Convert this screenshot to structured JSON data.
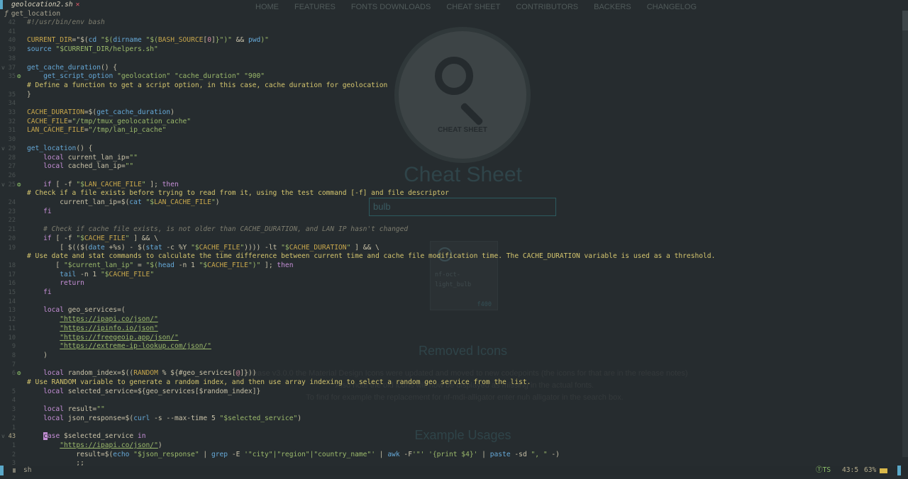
{
  "website": {
    "nav": [
      "HOME",
      "FEATURES",
      "FONTS DOWNLOADS",
      "CHEAT SHEET",
      "CONTRIBUTORS",
      "BACKERS",
      "CHANGELOG"
    ],
    "circle_label": "CHEAT SHEET",
    "title": "Cheat Sheet",
    "search_value": "bulb",
    "card_name_1": "nf-oct-",
    "card_name_2": "light_bulb",
    "card_code": "f400",
    "removed_title": "Removed Icons",
    "removed_text_1": "Release v3.0.0 the Material Design Icons were updated and moved to new codepoints (the icons for that are in the release notes)",
    "removed_text_2": "Also note the old icons will now be displayed as missing in the actual fonts.",
    "removed_text_3": "To find for example the replacement for nf-mdi-alligator enter nuh alligator in the search box.",
    "usage_title": "Example Usages"
  },
  "editor": {
    "tab_filename": "geolocation2.sh",
    "tab_modified": "✕",
    "winbar_icon": "ƒ",
    "winbar_symbol": "get_location",
    "filetype": "sh",
    "lsp": "ⓉTS",
    "cursor_pos": "43:5",
    "percent": "63%",
    "colors": {
      "accent": "#5aa8c8",
      "hint": "#d4c56e",
      "string": "#9bb96b",
      "function": "#66a9d8"
    }
  },
  "gutter": [
    {
      "n": "42",
      "fold": "",
      "bulb": false
    },
    {
      "n": "41",
      "fold": "",
      "bulb": false
    },
    {
      "n": "40",
      "fold": "",
      "bulb": false
    },
    {
      "n": "39",
      "fold": "",
      "bulb": false
    },
    {
      "n": "38",
      "fold": "",
      "bulb": false
    },
    {
      "n": "37",
      "fold": "v",
      "bulb": false
    },
    {
      "n": "35",
      "fold": "",
      "bulb": true
    },
    {
      "n": "",
      "fold": "",
      "bulb": false
    },
    {
      "n": "35",
      "fold": "",
      "bulb": false
    },
    {
      "n": "34",
      "fold": "",
      "bulb": false
    },
    {
      "n": "33",
      "fold": "",
      "bulb": false
    },
    {
      "n": "32",
      "fold": "",
      "bulb": false
    },
    {
      "n": "31",
      "fold": "",
      "bulb": false
    },
    {
      "n": "30",
      "fold": "",
      "bulb": false
    },
    {
      "n": "29",
      "fold": "v",
      "bulb": false
    },
    {
      "n": "28",
      "fold": "",
      "bulb": false
    },
    {
      "n": "27",
      "fold": "",
      "bulb": false
    },
    {
      "n": "26",
      "fold": "",
      "bulb": false
    },
    {
      "n": "25",
      "fold": "v",
      "bulb": true
    },
    {
      "n": "",
      "fold": "",
      "bulb": false
    },
    {
      "n": "24",
      "fold": "",
      "bulb": false
    },
    {
      "n": "23",
      "fold": "",
      "bulb": false
    },
    {
      "n": "22",
      "fold": "",
      "bulb": false
    },
    {
      "n": "21",
      "fold": "",
      "bulb": false
    },
    {
      "n": "20",
      "fold": "",
      "bulb": false
    },
    {
      "n": "19",
      "fold": "",
      "bulb": false
    },
    {
      "n": "",
      "fold": "",
      "bulb": false
    },
    {
      "n": "18",
      "fold": "",
      "bulb": false
    },
    {
      "n": "17",
      "fold": "",
      "bulb": false
    },
    {
      "n": "16",
      "fold": "",
      "bulb": false
    },
    {
      "n": "15",
      "fold": "",
      "bulb": false
    },
    {
      "n": "14",
      "fold": "",
      "bulb": false
    },
    {
      "n": "13",
      "fold": "",
      "bulb": false
    },
    {
      "n": "12",
      "fold": "",
      "bulb": false
    },
    {
      "n": "11",
      "fold": "",
      "bulb": false
    },
    {
      "n": "10",
      "fold": "",
      "bulb": false
    },
    {
      "n": "9",
      "fold": "",
      "bulb": false
    },
    {
      "n": "8",
      "fold": "",
      "bulb": false
    },
    {
      "n": "7",
      "fold": "",
      "bulb": false
    },
    {
      "n": "6",
      "fold": "",
      "bulb": true
    },
    {
      "n": "",
      "fold": "",
      "bulb": false
    },
    {
      "n": "5",
      "fold": "",
      "bulb": false
    },
    {
      "n": "4",
      "fold": "",
      "bulb": false
    },
    {
      "n": "3",
      "fold": "",
      "bulb": false
    },
    {
      "n": "2",
      "fold": "",
      "bulb": false
    },
    {
      "n": "1",
      "fold": "",
      "bulb": false
    },
    {
      "n": "43",
      "fold": "v",
      "bulb": false,
      "cur": true
    },
    {
      "n": "1",
      "fold": "",
      "bulb": false
    },
    {
      "n": "2",
      "fold": "",
      "bulb": false
    },
    {
      "n": "3",
      "fold": "",
      "bulb": false
    }
  ],
  "code_lines": [
    [
      [
        "cm",
        "#!/usr/bin/env bash"
      ]
    ],
    [],
    [
      [
        "vt",
        "CURRENT_DIR"
      ],
      [
        "op",
        "=\"$("
      ],
      [
        "fn",
        "cd"
      ],
      [
        "st",
        " \"$("
      ],
      [
        "fn",
        "dirname"
      ],
      [
        "st",
        " \"$("
      ],
      [
        "vt",
        "BASH_SOURCE"
      ],
      [
        "op",
        "["
      ],
      [
        "nm",
        "0"
      ],
      [
        "op",
        "]"
      ],
      [
        "st",
        "}\")\""
      ],
      [
        "op",
        " && "
      ],
      [
        "fn",
        "pwd"
      ],
      [
        "st",
        ")\""
      ]
    ],
    [
      [
        "fn",
        "source"
      ],
      [
        "st",
        " \"$CURRENT_DIR/helpers.sh\""
      ]
    ],
    [],
    [
      [
        "fn",
        "get_cache_duration"
      ],
      [
        "op",
        "() {"
      ]
    ],
    [
      [
        "op",
        "    "
      ],
      [
        "fn",
        "get_script_option"
      ],
      [
        "st",
        " \"geolocation\" \"cache_duration\" \"900\""
      ]
    ],
    [
      [
        "ai",
        "# Define a function to get a script option, in this case, cache duration for geolocation"
      ]
    ],
    [
      [
        "op",
        "}"
      ]
    ],
    [],
    [
      [
        "vt",
        "CACHE_DURATION"
      ],
      [
        "op",
        "=$("
      ],
      [
        "fn",
        "get_cache_duration"
      ],
      [
        "op",
        ")"
      ]
    ],
    [
      [
        "vt",
        "CACHE_FILE"
      ],
      [
        "op",
        "="
      ],
      [
        "st",
        "\"/tmp/tmux_geolocation_cache\""
      ]
    ],
    [
      [
        "vt",
        "LAN_CACHE_FILE"
      ],
      [
        "op",
        "="
      ],
      [
        "st",
        "\"/tmp/lan_ip_cache\""
      ]
    ],
    [],
    [
      [
        "fn",
        "get_location"
      ],
      [
        "op",
        "() {"
      ]
    ],
    [
      [
        "op",
        "    "
      ],
      [
        "kw",
        "local"
      ],
      [
        "op",
        " current_lan_ip="
      ],
      [
        "st",
        "\"\""
      ]
    ],
    [
      [
        "op",
        "    "
      ],
      [
        "kw",
        "local"
      ],
      [
        "op",
        " cached_lan_ip="
      ],
      [
        "st",
        "\"\""
      ]
    ],
    [],
    [
      [
        "op",
        "    "
      ],
      [
        "kw",
        "if"
      ],
      [
        "op",
        " [ -f "
      ],
      [
        "st",
        "\"$"
      ],
      [
        "vt",
        "LAN_CACHE_FILE"
      ],
      [
        "st",
        "\""
      ],
      [
        "op",
        " ]; "
      ],
      [
        "kw",
        "then"
      ]
    ],
    [
      [
        "ai",
        "# Check if a file exists before trying to read from it, using the test command [-f] and file descriptor"
      ]
    ],
    [
      [
        "op",
        "        current_lan_ip=$("
      ],
      [
        "fn",
        "cat"
      ],
      [
        "st",
        " \"$"
      ],
      [
        "vt",
        "LAN_CACHE_FILE"
      ],
      [
        "st",
        "\""
      ],
      [
        "op",
        ")"
      ]
    ],
    [
      [
        "op",
        "    "
      ],
      [
        "kw",
        "fi"
      ]
    ],
    [],
    [
      [
        "op",
        "    "
      ],
      [
        "cm",
        "# Check if cache file exists, is not older than CACHE_DURATION, and LAN IP hasn't changed"
      ]
    ],
    [
      [
        "op",
        "    "
      ],
      [
        "kw",
        "if"
      ],
      [
        "op",
        " [ -f "
      ],
      [
        "st",
        "\"$"
      ],
      [
        "vt",
        "CACHE_FILE"
      ],
      [
        "st",
        "\""
      ],
      [
        "op",
        " ] && \\"
      ]
    ],
    [
      [
        "op",
        "        [ $(($("
      ],
      [
        "fn",
        "date"
      ],
      [
        "op",
        " +%s) - $("
      ],
      [
        "fn",
        "stat"
      ],
      [
        "op",
        " -c %Y "
      ],
      [
        "st",
        "\"$"
      ],
      [
        "vt",
        "CACHE_FILE"
      ],
      [
        "st",
        "\""
      ],
      [
        "op",
        ")))) -lt "
      ],
      [
        "st",
        "\"$"
      ],
      [
        "vt",
        "CACHE_DURATION"
      ],
      [
        "st",
        "\""
      ],
      [
        "op",
        " ] && \\"
      ]
    ],
    [
      [
        "ai",
        "# Use date and stat commands to calculate the time difference between current time and cache file modification time. The CACHE_DURATION variable is used as a threshold."
      ]
    ],
    [
      [
        "op",
        "       [ "
      ],
      [
        "st",
        "\"$current_lan_ip\""
      ],
      [
        "op",
        " = "
      ],
      [
        "st",
        "\"$("
      ],
      [
        "fn",
        "head"
      ],
      [
        "op",
        " -n 1 "
      ],
      [
        "st",
        "\"$"
      ],
      [
        "vt",
        "CACHE_FILE"
      ],
      [
        "st",
        "\")\""
      ],
      [
        "op",
        " ]; "
      ],
      [
        "kw",
        "then"
      ]
    ],
    [
      [
        "op",
        "        "
      ],
      [
        "fn",
        "tail"
      ],
      [
        "op",
        " -n 1 "
      ],
      [
        "st",
        "\"$"
      ],
      [
        "vt",
        "CACHE_FILE"
      ],
      [
        "st",
        "\""
      ]
    ],
    [
      [
        "op",
        "        "
      ],
      [
        "kw",
        "return"
      ]
    ],
    [
      [
        "op",
        "    "
      ],
      [
        "kw",
        "fi"
      ]
    ],
    [],
    [
      [
        "op",
        "    "
      ],
      [
        "kw",
        "local"
      ],
      [
        "op",
        " geo_services=("
      ]
    ],
    [
      [
        "op",
        "        "
      ],
      [
        "url",
        "\"https://ipapi.co/json/\""
      ]
    ],
    [
      [
        "op",
        "        "
      ],
      [
        "url",
        "\"https://ipinfo.io/json\""
      ]
    ],
    [
      [
        "op",
        "        "
      ],
      [
        "url",
        "\"https://freegeoip.app/json/\""
      ]
    ],
    [
      [
        "op",
        "        "
      ],
      [
        "url",
        "\"https://extreme-ip-lookup.com/json/\""
      ]
    ],
    [
      [
        "op",
        "    )"
      ]
    ],
    [],
    [
      [
        "op",
        "    "
      ],
      [
        "kw",
        "local"
      ],
      [
        "op",
        " random_index=$(("
      ],
      [
        "vt",
        "RANDOM"
      ],
      [
        "op",
        " % ${#geo_services["
      ],
      [
        "nm",
        "@"
      ],
      [
        "op",
        "]}))"
      ]
    ],
    [
      [
        "ai",
        "# Use RANDOM variable to generate a random index, and then use array indexing to select a random geo service from the list."
      ]
    ],
    [
      [
        "op",
        "    "
      ],
      [
        "kw",
        "local"
      ],
      [
        "op",
        " selected_service=${geo_services[$random_index]}"
      ]
    ],
    [],
    [
      [
        "op",
        "    "
      ],
      [
        "kw",
        "local"
      ],
      [
        "op",
        " result="
      ],
      [
        "st",
        "\"\""
      ]
    ],
    [
      [
        "op",
        "    "
      ],
      [
        "kw",
        "local"
      ],
      [
        "op",
        " json_response=$("
      ],
      [
        "fn",
        "curl"
      ],
      [
        "op",
        " -s --max-time 5 "
      ],
      [
        "st",
        "\"$selected_service\""
      ],
      [
        "op",
        ")"
      ]
    ],
    [],
    [
      [
        "op",
        "    "
      ],
      [
        "cursor",
        "c"
      ],
      [
        "kw",
        "ase"
      ],
      [
        "op",
        " $selected_service "
      ],
      [
        "kw",
        "in"
      ]
    ],
    [
      [
        "op",
        "        "
      ],
      [
        "url",
        "\"https://ipapi.co/json/\""
      ],
      [
        "op",
        ")"
      ]
    ],
    [
      [
        "op",
        "            result=$("
      ],
      [
        "fn",
        "echo"
      ],
      [
        "st",
        " \"$json_response\""
      ],
      [
        "op",
        " | "
      ],
      [
        "fn",
        "grep"
      ],
      [
        "op",
        " -E "
      ],
      [
        "st",
        "'\"city\"|\"region\"|\"country_name\"'"
      ],
      [
        "op",
        " | "
      ],
      [
        "fn",
        "awk"
      ],
      [
        "op",
        " -F"
      ],
      [
        "st",
        "'\"'"
      ],
      [
        "st",
        " '{print $4}'"
      ],
      [
        "op",
        " | "
      ],
      [
        "fn",
        "paste"
      ],
      [
        "op",
        " -sd "
      ],
      [
        "st",
        "\", \""
      ],
      [
        "op",
        " -)"
      ]
    ],
    [
      [
        "op",
        "            ;;"
      ]
    ]
  ]
}
